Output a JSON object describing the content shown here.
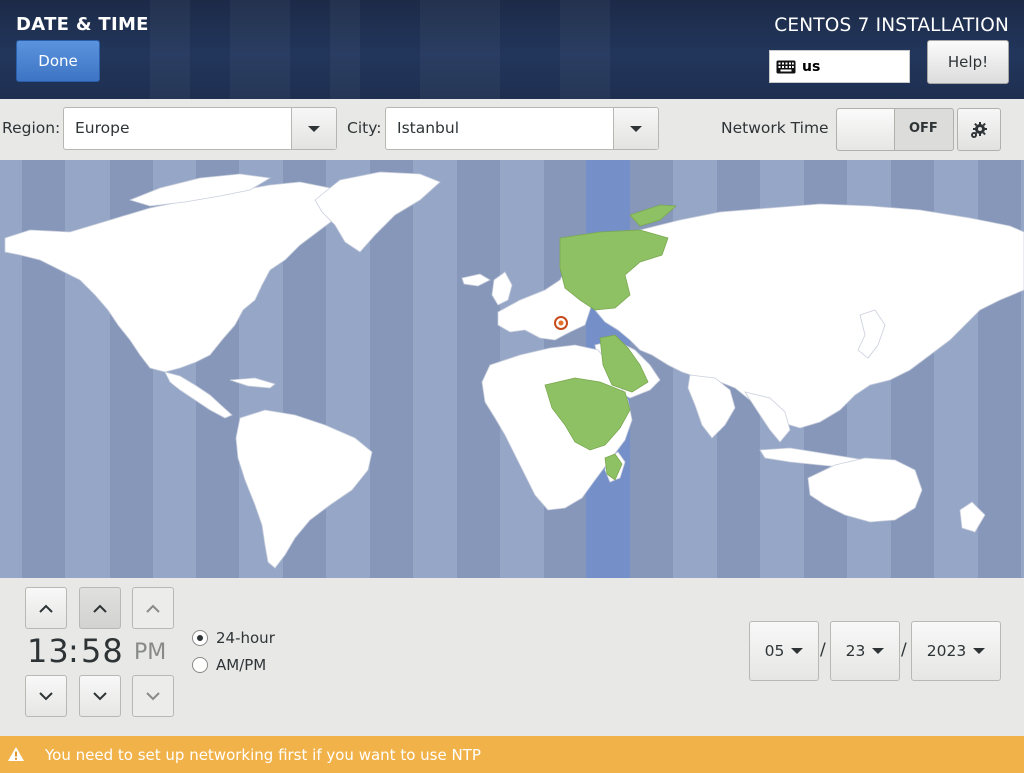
{
  "header": {
    "screen_title": "DATE & TIME",
    "done_label": "Done",
    "product_title": "CENTOS 7 INSTALLATION",
    "keyboard_layout": "us",
    "help_label": "Help!"
  },
  "toolbar": {
    "region_label": "Region:",
    "region_value": "Europe",
    "city_label": "City:",
    "city_value": "Istanbul",
    "network_time_label": "Network Time",
    "network_time_state": "OFF"
  },
  "map": {
    "selected_city": "Istanbul",
    "colors": {
      "ocean": "#95a6c7",
      "land": "#ffffff",
      "highlight_zone": "#8ec163",
      "highlight_band": "#7590c9"
    }
  },
  "time": {
    "hours": "13",
    "separator": ":",
    "minutes": "58",
    "ampm": "PM",
    "format_24h_label": "24-hour",
    "format_ampm_label": "AM/PM",
    "selected_format": "24-hour"
  },
  "date": {
    "month": "05",
    "day": "23",
    "year": "2023",
    "separator": "/"
  },
  "warning": {
    "text": "You need to set up networking first if you want to use NTP",
    "color": "#f1b24a"
  }
}
